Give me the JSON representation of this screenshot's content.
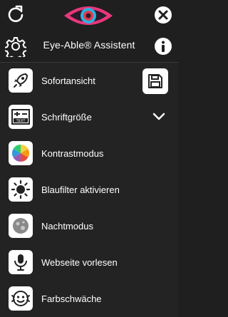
{
  "header": {
    "title": "Eye-Able® Assistent"
  },
  "menu": [
    {
      "label": "Sofortansicht",
      "icon": "rocket-icon"
    },
    {
      "label": "Schriftgröße",
      "icon": "text-size-icon"
    },
    {
      "label": "Kontrastmodus",
      "icon": "color-wheel-icon"
    },
    {
      "label": "Blaufilter aktivieren",
      "icon": "sun-icon"
    },
    {
      "label": "Nachtmodus",
      "icon": "moon-icon"
    },
    {
      "label": "Webseite vorlesen",
      "icon": "microphone-icon"
    },
    {
      "label": "Farbschwäche",
      "icon": "face-icon"
    }
  ],
  "colors": {
    "background": "#232323",
    "logo_pink": "#e8377b",
    "logo_red": "#e23c4a",
    "logo_blue": "#2bb2e0"
  }
}
